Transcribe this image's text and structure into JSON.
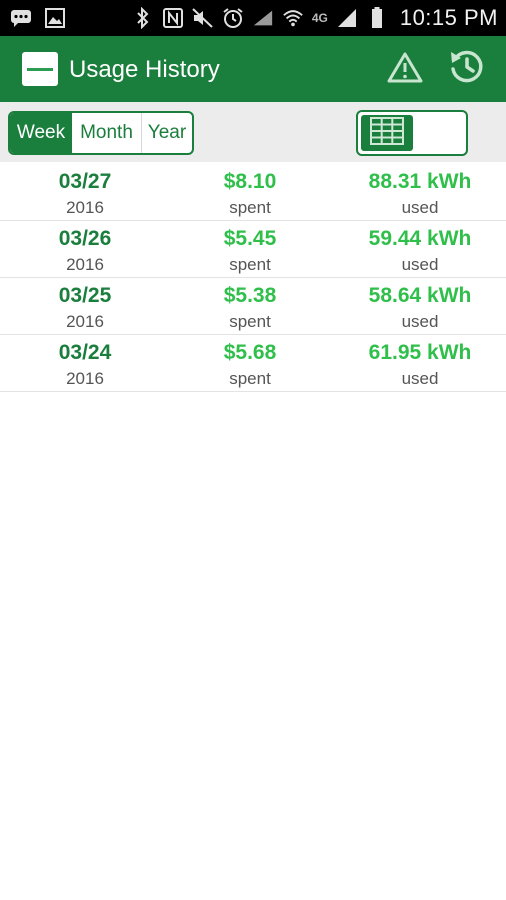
{
  "status_bar": {
    "time": "10:15 PM",
    "network": "4G"
  },
  "app_bar": {
    "title": "Usage History"
  },
  "period_tabs": {
    "week": "Week",
    "month": "Month",
    "year": "Year",
    "selected": "Week"
  },
  "view_mode": "table",
  "usage": [
    {
      "date": "03/27",
      "year": "2016",
      "cost": "$8.10",
      "cost_label": "spent",
      "kwh": "88.31 kWh",
      "kwh_label": "used"
    },
    {
      "date": "03/26",
      "year": "2016",
      "cost": "$5.45",
      "cost_label": "spent",
      "kwh": "59.44 kWh",
      "kwh_label": "used"
    },
    {
      "date": "03/25",
      "year": "2016",
      "cost": "$5.38",
      "cost_label": "spent",
      "kwh": "58.64 kWh",
      "kwh_label": "used"
    },
    {
      "date": "03/24",
      "year": "2016",
      "cost": "$5.68",
      "cost_label": "spent",
      "kwh": "61.95 kWh",
      "kwh_label": "used"
    }
  ],
  "colors": {
    "primary": "#1a7e3c",
    "accent": "#2fbf4a"
  }
}
